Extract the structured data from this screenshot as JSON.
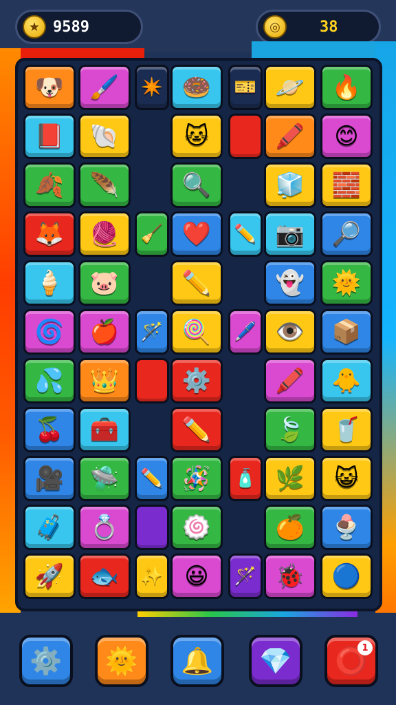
{
  "hud": {
    "score": "9589",
    "score_icon": "trophy-icon",
    "coins": "38",
    "coins_icon": "coin-icon"
  },
  "colors": {
    "yellow": "#ffc814",
    "orange": "#ff8a1a",
    "magenta": "#d94ad0",
    "cyan": "#38c6ee",
    "green": "#35b843",
    "red": "#e8281e",
    "blue": "#2f86e6",
    "purple": "#7a2ccf"
  },
  "board": {
    "rows": [
      [
        {
          "icon": "dog-face-icon",
          "glyph": "🐶",
          "color": "orange"
        },
        {
          "icon": "paintbrush-icon",
          "glyph": "🖌️",
          "color": "magenta"
        },
        {
          "icon": "star-badge-icon",
          "glyph": "✴️",
          "color": "navy"
        },
        {
          "icon": "donut-icon",
          "glyph": "🍩",
          "color": "cyan"
        },
        {
          "icon": "ticket-icon",
          "glyph": "🎫",
          "color": "navy"
        },
        {
          "icon": "planet-icon",
          "glyph": "🪐",
          "color": "yellow"
        },
        {
          "icon": "torch-icon",
          "glyph": "🔥",
          "color": "green"
        }
      ],
      [
        {
          "icon": "book-icon",
          "glyph": "📕",
          "color": "cyan"
        },
        {
          "icon": "shell-icon",
          "glyph": "🐚",
          "color": "yellow"
        },
        {
          "icon": "cat-face-icon",
          "glyph": "🐱",
          "color": "yellow"
        },
        {
          "icon": "red-block-icon",
          "glyph": "",
          "color": "red"
        },
        {
          "icon": "crayon-icon",
          "glyph": "🖍️",
          "color": "orange"
        },
        {
          "icon": "smiley-icon",
          "glyph": "😊",
          "color": "magenta"
        }
      ],
      [
        {
          "icon": "flame-leaf-icon",
          "glyph": "🍂",
          "color": "green"
        },
        {
          "icon": "feather-brush-icon",
          "glyph": "🪶",
          "color": "green"
        },
        {
          "icon": "magnifier-icon",
          "glyph": "🔍",
          "color": "green"
        },
        {
          "icon": "cube-face-icon",
          "glyph": "🧊",
          "color": "yellow"
        },
        {
          "icon": "toy-block-icon",
          "glyph": "🧱",
          "color": "yellow"
        }
      ],
      [
        {
          "icon": "fox-face-icon",
          "glyph": "🦊",
          "color": "red"
        },
        {
          "icon": "yarn-ball-icon",
          "glyph": "🧶",
          "color": "yellow"
        },
        {
          "icon": "broom-icon",
          "glyph": "🧹",
          "color": "green"
        },
        {
          "icon": "heart-blob-icon",
          "glyph": "❤️",
          "color": "blue"
        },
        {
          "icon": "pencil-icon",
          "glyph": "✏️",
          "color": "cyan"
        },
        {
          "icon": "camera-icon",
          "glyph": "📷",
          "color": "cyan"
        },
        {
          "icon": "magnifying-glass-icon",
          "glyph": "🔎",
          "color": "blue"
        }
      ],
      [
        {
          "icon": "ice-cream-icon",
          "glyph": "🍦",
          "color": "cyan"
        },
        {
          "icon": "pig-face-icon",
          "glyph": "🐷",
          "color": "green"
        },
        {
          "icon": "pencil-icon",
          "glyph": "✏️",
          "color": "yellow"
        },
        {
          "icon": "ghost-blob-icon",
          "glyph": "👻",
          "color": "blue"
        },
        {
          "icon": "sun-face-icon",
          "glyph": "🌞",
          "color": "green"
        }
      ],
      [
        {
          "icon": "swirl-icon",
          "glyph": "🌀",
          "color": "magenta"
        },
        {
          "icon": "apple-icon",
          "glyph": "🍎",
          "color": "magenta"
        },
        {
          "icon": "wand-icon",
          "glyph": "🪄",
          "color": "blue"
        },
        {
          "icon": "lollipop-icon",
          "glyph": "🍭",
          "color": "yellow"
        },
        {
          "icon": "pen-icon",
          "glyph": "🖊️",
          "color": "magenta"
        },
        {
          "icon": "eye-icon",
          "glyph": "👁️",
          "color": "yellow"
        },
        {
          "icon": "box-icon",
          "glyph": "📦",
          "color": "blue"
        }
      ],
      [
        {
          "icon": "splash-icon",
          "glyph": "💦",
          "color": "green"
        },
        {
          "icon": "crown-face-icon",
          "glyph": "👑",
          "color": "orange"
        },
        {
          "icon": "red-block-icon",
          "glyph": "",
          "color": "red"
        },
        {
          "icon": "gear-face-icon",
          "glyph": "⚙️",
          "color": "red"
        },
        {
          "icon": "crayon-icon",
          "glyph": "🖍️",
          "color": "magenta"
        },
        {
          "icon": "chick-icon",
          "glyph": "🐥",
          "color": "cyan"
        }
      ],
      [
        {
          "icon": "cherry-icon",
          "glyph": "🍒",
          "color": "blue"
        },
        {
          "icon": "treasure-box-icon",
          "glyph": "🧰",
          "color": "cyan"
        },
        {
          "icon": "pencil-icon",
          "glyph": "✏️",
          "color": "red"
        },
        {
          "icon": "leaf-icon",
          "glyph": "🍃",
          "color": "green"
        },
        {
          "icon": "cup-icon",
          "glyph": "🥤",
          "color": "yellow"
        }
      ],
      [
        {
          "icon": "projector-icon",
          "glyph": "🎥",
          "color": "blue"
        },
        {
          "icon": "ufo-icon",
          "glyph": "🛸",
          "color": "green"
        },
        {
          "icon": "pencil-icon",
          "glyph": "✏️",
          "color": "blue"
        },
        {
          "icon": "rattle-icon",
          "glyph": "🪅",
          "color": "green"
        },
        {
          "icon": "bottle-icon",
          "glyph": "🧴",
          "color": "red"
        },
        {
          "icon": "leaf-icon",
          "glyph": "🌿",
          "color": "yellow"
        },
        {
          "icon": "cat-face-icon",
          "glyph": "😺",
          "color": "yellow"
        }
      ],
      [
        {
          "icon": "crate-icon",
          "glyph": "🧳",
          "color": "cyan"
        },
        {
          "icon": "ring-icon",
          "glyph": "💍",
          "color": "magenta"
        },
        {
          "icon": "purple-block-icon",
          "glyph": "",
          "color": "purple"
        },
        {
          "icon": "spiral-cake-icon",
          "glyph": "🍥",
          "color": "green"
        },
        {
          "icon": "orange-ball-icon",
          "glyph": "🍊",
          "color": "green"
        },
        {
          "icon": "ice-cream-icon",
          "glyph": "🍨",
          "color": "blue"
        }
      ],
      [
        {
          "icon": "rocket-icon",
          "glyph": "🚀",
          "color": "yellow"
        },
        {
          "icon": "fish-icon",
          "glyph": "🐟",
          "color": "red"
        },
        {
          "icon": "sparkle-icon",
          "glyph": "✨",
          "color": "yellow"
        },
        {
          "icon": "smiley-icon",
          "glyph": "😃",
          "color": "magenta"
        },
        {
          "icon": "wand-icon",
          "glyph": "🪄",
          "color": "purple"
        },
        {
          "icon": "bug-icon",
          "glyph": "🐞",
          "color": "magenta"
        },
        {
          "icon": "blue-orb-icon",
          "glyph": "🔵",
          "color": "yellow"
        }
      ]
    ]
  },
  "toolbar": [
    {
      "icon": "settings-gear-icon",
      "glyph": "⚙️",
      "color": "blue"
    },
    {
      "icon": "sun-burst-icon",
      "glyph": "🌞",
      "color": "orange"
    },
    {
      "icon": "hint-ring-icon",
      "glyph": "🔔",
      "color": "blue"
    },
    {
      "icon": "crystal-icon",
      "glyph": "💎",
      "color": "purple"
    },
    {
      "icon": "notification-icon",
      "glyph": "⭕",
      "color": "red",
      "badge": "1"
    }
  ]
}
